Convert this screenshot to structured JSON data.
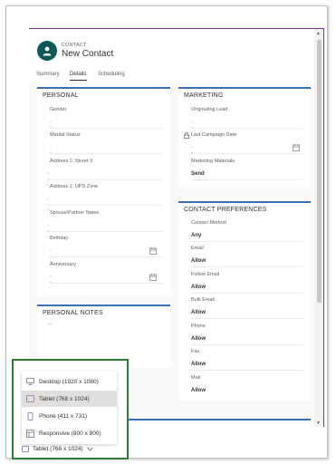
{
  "record": {
    "entity_type": "CONTACT",
    "title": "New Contact",
    "avatar_icon": "contact-person-icon"
  },
  "tabs": [
    {
      "label": "Summary"
    },
    {
      "label": "Details"
    },
    {
      "label": "Scheduling"
    }
  ],
  "personal": {
    "title": "PERSONAL",
    "fields": [
      {
        "label": "Gender",
        "value": "---"
      },
      {
        "label": "Marital Status",
        "value": "---"
      },
      {
        "label": "Address 1: Street 3",
        "value": "---"
      },
      {
        "label": "Address 1: UPS Zone",
        "value": "---"
      },
      {
        "label": "Spouse/Partner Name",
        "value": "---"
      },
      {
        "label": "Birthday",
        "value": "---"
      },
      {
        "label": "Anniversary",
        "value": "---"
      }
    ]
  },
  "personal_notes": {
    "title": "PERSONAL NOTES",
    "value": "---"
  },
  "marketing": {
    "title": "MARKETING",
    "fields": [
      {
        "label": "Originating Lead",
        "value": "---"
      },
      {
        "label": "Last Campaign Date",
        "value": "---"
      },
      {
        "label": "Marketing Materials",
        "value": "Send"
      }
    ]
  },
  "contact_prefs": {
    "title": "CONTACT PREFERENCES",
    "fields": [
      {
        "label": "Contact Method",
        "value": "Any"
      },
      {
        "label": "Email",
        "value": "Allow"
      },
      {
        "label": "Follow Email",
        "value": "Allow"
      },
      {
        "label": "Bulk Email",
        "value": "Allow"
      },
      {
        "label": "Phone",
        "value": "Allow"
      },
      {
        "label": "Fax",
        "value": "Allow"
      },
      {
        "label": "Mail",
        "value": "Allow"
      }
    ]
  },
  "device_menu": {
    "items": [
      {
        "label": "Desktop (1920 x 1080)",
        "icon": "desktop-icon"
      },
      {
        "label": "Tablet (768 x 1024)",
        "icon": "tablet-icon",
        "selected": true
      },
      {
        "label": "Phone (411 x 731)",
        "icon": "phone-icon"
      },
      {
        "label": "Responsive (800 x 800)",
        "icon": "responsive-icon"
      }
    ],
    "current": "Tablet (768 x 1024)"
  },
  "colors": {
    "section_accent": "#3a70b8",
    "avatar_bg": "#0b5a58",
    "device_frame": "#7a3a8e",
    "highlight_box": "#2e7d32",
    "menu_icon": "#8764b8"
  }
}
